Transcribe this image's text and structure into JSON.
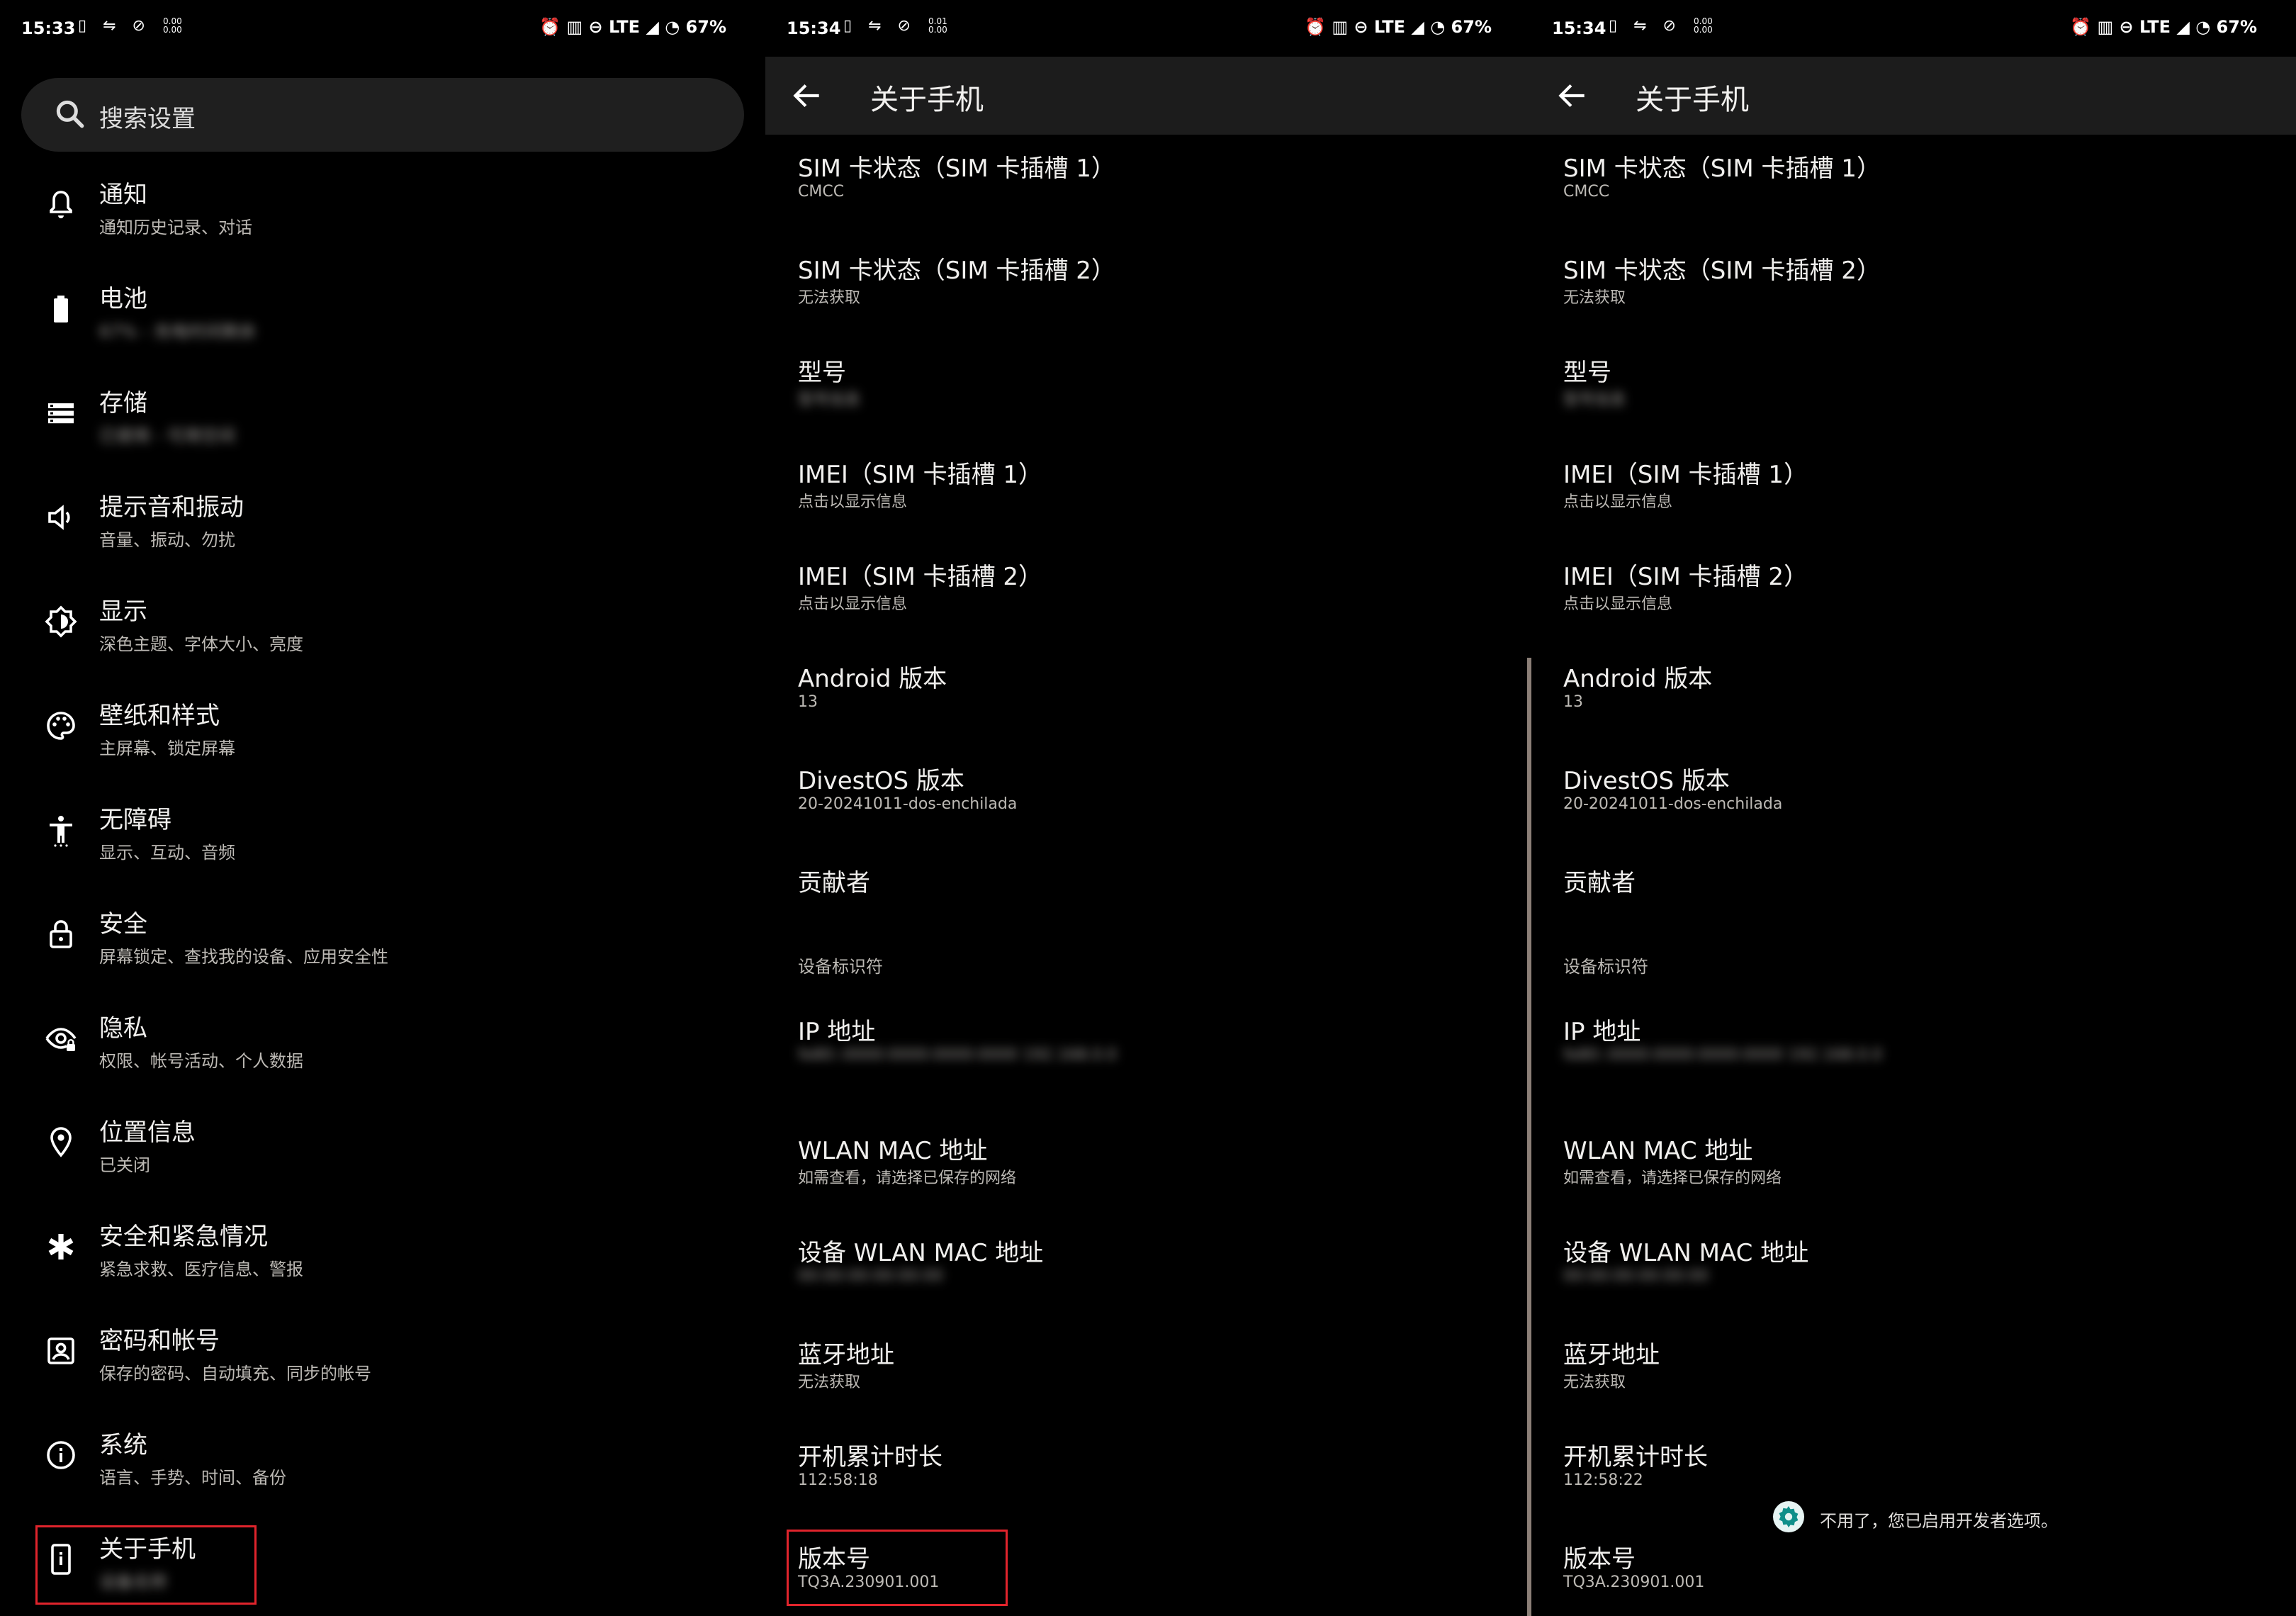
{
  "status_bars": [
    {
      "time": "15:33",
      "battery": "67%",
      "network": "LTE",
      "speed_up": "0.00",
      "speed_down": "0.00"
    },
    {
      "time": "15:34",
      "battery": "67%",
      "network": "LTE",
      "speed_up": "0.01",
      "speed_down": "0.00"
    },
    {
      "time": "15:34",
      "battery": "67%",
      "network": "LTE",
      "speed_up": "0.00",
      "speed_down": "0.00"
    }
  ],
  "settings": {
    "search_placeholder": "搜索设置",
    "items": [
      {
        "title": "通知",
        "subtitle": "通知历史记录、对话",
        "icon": "bell-icon"
      },
      {
        "title": "电池",
        "subtitle": "67% - 充电时间剩余",
        "icon": "battery-icon",
        "blurred": true
      },
      {
        "title": "存储",
        "subtitle": "已使用 - 可用空间",
        "icon": "storage-icon",
        "blurred": true
      },
      {
        "title": "提示音和振动",
        "subtitle": "音量、振动、勿扰",
        "icon": "volume-icon"
      },
      {
        "title": "显示",
        "subtitle": "深色主题、字体大小、亮度",
        "icon": "brightness-icon"
      },
      {
        "title": "壁纸和样式",
        "subtitle": "主屏幕、锁定屏幕",
        "icon": "palette-icon"
      },
      {
        "title": "无障碍",
        "subtitle": "显示、互动、音频",
        "icon": "accessibility-icon"
      },
      {
        "title": "安全",
        "subtitle": "屏幕锁定、查找我的设备、应用安全性",
        "icon": "lock-icon"
      },
      {
        "title": "隐私",
        "subtitle": "权限、帐号活动、个人数据",
        "icon": "privacy-eye-icon"
      },
      {
        "title": "位置信息",
        "subtitle": "已关闭",
        "icon": "location-pin-icon"
      },
      {
        "title": "安全和紧急情况",
        "subtitle": "紧急求救、医疗信息、警报",
        "icon": "emergency-asterisk-icon"
      },
      {
        "title": "密码和帐号",
        "subtitle": "保存的密码、自动填充、同步的帐号",
        "icon": "account-box-icon"
      },
      {
        "title": "系统",
        "subtitle": "语言、手势、时间、备份",
        "icon": "info-icon"
      },
      {
        "title": "关于手机",
        "subtitle": "设备名称",
        "icon": "phone-info-icon",
        "blurred": true
      }
    ]
  },
  "about": {
    "title": "关于手机",
    "section_label": "设备标识符",
    "items_left": [
      {
        "title": "SIM 卡状态（SIM 卡插槽 1）",
        "subtitle": "CMCC"
      },
      {
        "title": "SIM 卡状态（SIM 卡插槽 2）",
        "subtitle": "无法获取"
      },
      {
        "title": "型号",
        "subtitle": "型号信息",
        "blurred": true
      },
      {
        "title": "IMEI（SIM 卡插槽 1）",
        "subtitle": "点击以显示信息"
      },
      {
        "title": "IMEI（SIM 卡插槽 2）",
        "subtitle": "点击以显示信息"
      },
      {
        "title": "Android 版本",
        "subtitle": "13"
      },
      {
        "title": "DivestOS 版本",
        "subtitle": "20-20241011-dos-enchilada"
      },
      {
        "title": "贡献者",
        "subtitle": ""
      },
      {
        "title": "IP 地址",
        "subtitle": "fe80::0000:0000:0000:0000 192.168.0.0",
        "blurred": true
      },
      {
        "title": "WLAN MAC 地址",
        "subtitle": "如需查看，请选择已保存的网络"
      },
      {
        "title": "设备 WLAN MAC 地址",
        "subtitle": "00:00:00:00:00:00",
        "blurred": true
      },
      {
        "title": "蓝牙地址",
        "subtitle": "无法获取"
      },
      {
        "title": "开机累计时长",
        "subtitle": "112:58:18"
      },
      {
        "title": "版本号",
        "subtitle": "TQ3A.230901.001"
      }
    ],
    "uptime_right": "112:58:22",
    "toast": "不用了，您已启用开发者选项。"
  },
  "colors": {
    "highlight_border": "#e0242c",
    "appbar_bg": "#1c1c1c",
    "search_bg": "#1f1f1f"
  }
}
